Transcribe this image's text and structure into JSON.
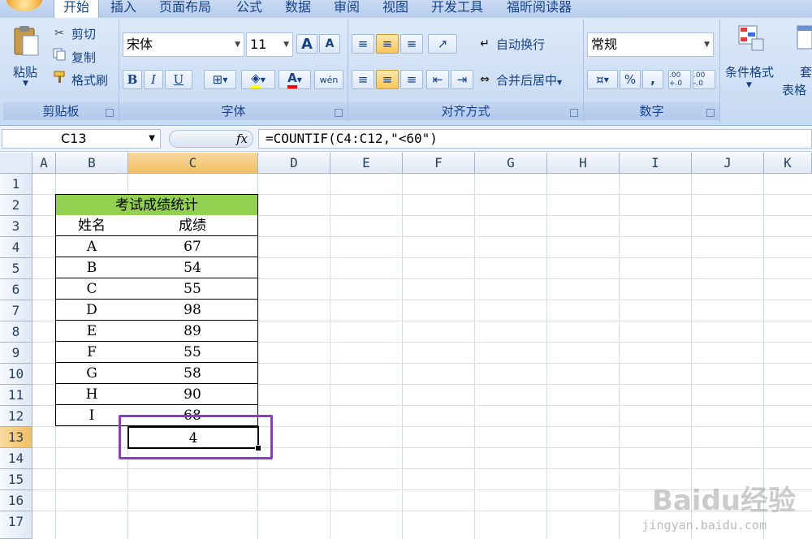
{
  "ribbon": {
    "tabs": [
      "开始",
      "插入",
      "页面布局",
      "公式",
      "数据",
      "审阅",
      "视图",
      "开发工具",
      "福昕阅读器"
    ],
    "clipboard": {
      "label": "剪贴板",
      "paste": "粘贴",
      "cut": "剪切",
      "copy": "复制",
      "format_painter": "格式刷"
    },
    "font": {
      "label": "字体",
      "name": "宋体",
      "size": "11",
      "bold": "B",
      "italic": "I",
      "underline": "U",
      "grow": "A",
      "shrink": "A",
      "font_color": "A",
      "phonetic": "wén"
    },
    "alignment": {
      "label": "对齐方式",
      "wrap_text": "自动换行",
      "merge_center": "合并后居中"
    },
    "number": {
      "label": "数字",
      "format": "常规",
      "percent": "%",
      "comma": ",",
      "increase_decimal": ".00 +.0",
      "decrease_decimal": ".00 -.0"
    },
    "styles": {
      "conditional_format": "条件格式",
      "table_format_partial": "套",
      "table_format_partial2": "表格"
    }
  },
  "formula_bar": {
    "name_box": "C13",
    "fx": "fx",
    "formula": "=COUNTIF(C4:C12,\"<60\")"
  },
  "sheet": {
    "columns": [
      "A",
      "B",
      "C",
      "D",
      "E",
      "F",
      "G",
      "H",
      "I",
      "J",
      "K"
    ],
    "rows": [
      "1",
      "2",
      "3",
      "4",
      "5",
      "6",
      "7",
      "8",
      "9",
      "10",
      "11",
      "12",
      "13",
      "14",
      "15",
      "16",
      "17"
    ],
    "table_title": "考试成绩统计",
    "header_name": "姓名",
    "header_score": "成绩",
    "records": [
      {
        "name": "A",
        "score": "67"
      },
      {
        "name": "B",
        "score": "54"
      },
      {
        "name": "C",
        "score": "55"
      },
      {
        "name": "D",
        "score": "98"
      },
      {
        "name": "E",
        "score": "89"
      },
      {
        "name": "F",
        "score": "55"
      },
      {
        "name": "G",
        "score": "58"
      },
      {
        "name": "H",
        "score": "90"
      },
      {
        "name": "I",
        "score": "68"
      }
    ],
    "result": "4",
    "selected_cell": "C13"
  },
  "watermark": {
    "brand": "Baidu经验",
    "url": "jingyan.baidu.com"
  },
  "colors": {
    "title_fill": "#92d050",
    "highlight": "#8a3cc8",
    "selected_header": "#f1bf63"
  }
}
